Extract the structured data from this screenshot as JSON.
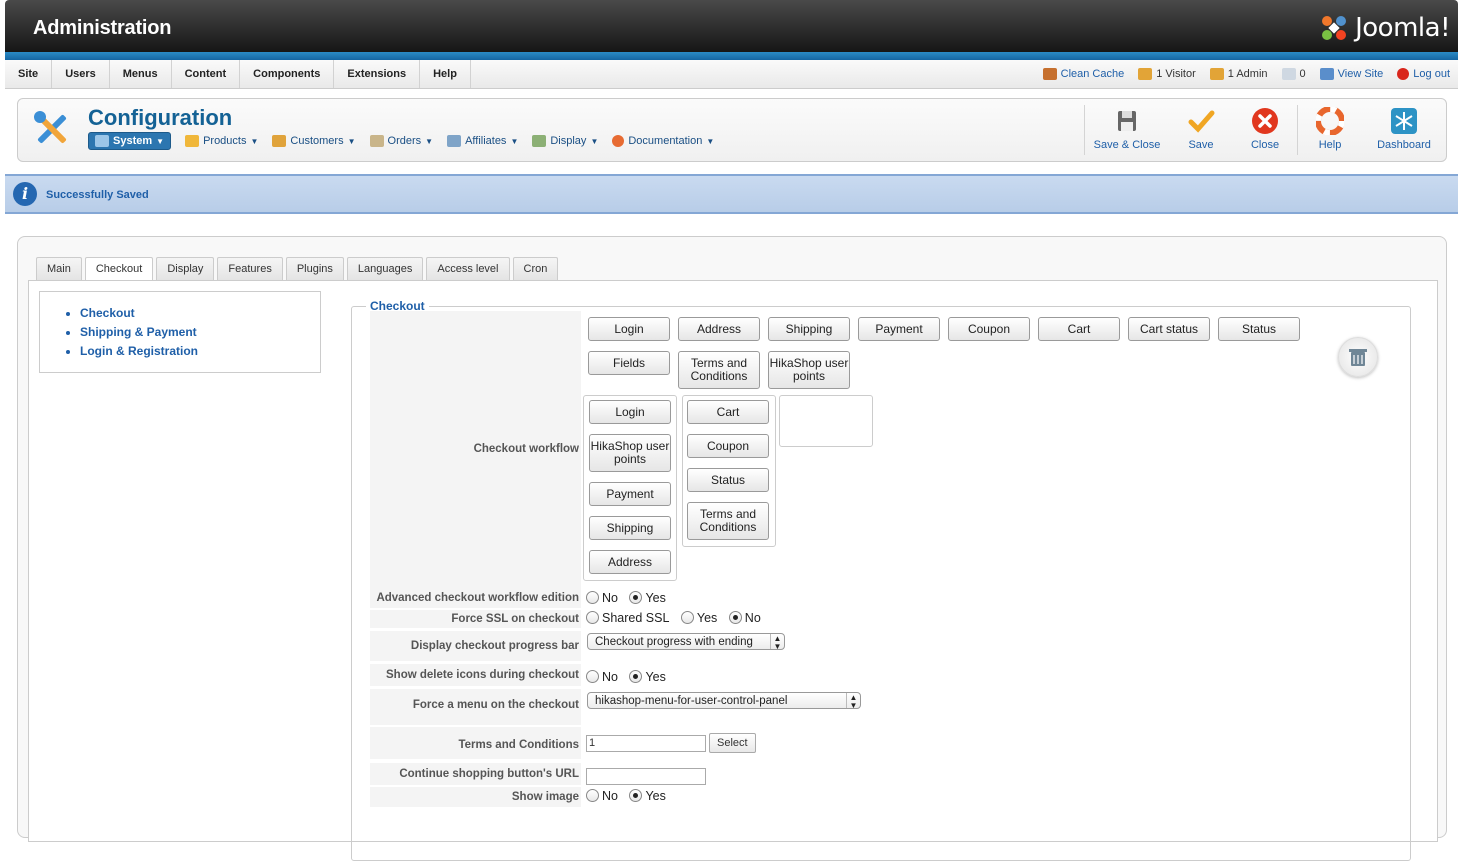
{
  "header": {
    "title": "Administration",
    "brand": "Joomla!"
  },
  "menu": [
    "Site",
    "Users",
    "Menus",
    "Content",
    "Components",
    "Extensions",
    "Help"
  ],
  "status": {
    "clean_cache": "Clean Cache",
    "visitors": "1 Visitor",
    "admins": "1 Admin",
    "messages": "0",
    "view_site": "View Site",
    "logout": "Log out"
  },
  "toolbar": {
    "title": "Configuration",
    "submenu": [
      {
        "label": "System",
        "icon": "tools-icon"
      },
      {
        "label": "Products",
        "icon": "box-icon"
      },
      {
        "label": "Customers",
        "icon": "users-icon"
      },
      {
        "label": "Orders",
        "icon": "orders-icon"
      },
      {
        "label": "Affiliates",
        "icon": "affiliates-icon"
      },
      {
        "label": "Display",
        "icon": "display-icon"
      },
      {
        "label": "Documentation",
        "icon": "lifebuoy-icon"
      }
    ],
    "buttons": [
      {
        "label": "Save & Close",
        "icon": "floppy-icon"
      },
      {
        "label": "Save",
        "icon": "checkmark-icon"
      },
      {
        "label": "Close",
        "icon": "close-icon"
      },
      {
        "label": "Help",
        "icon": "lifebuoy-icon"
      },
      {
        "label": "Dashboard",
        "icon": "dashboard-icon"
      }
    ]
  },
  "message": {
    "text": "Successfully Saved",
    "icon": "info-icon"
  },
  "tabs": [
    "Main",
    "Checkout",
    "Display",
    "Features",
    "Plugins",
    "Languages",
    "Access level",
    "Cron"
  ],
  "active_tab": "Checkout",
  "sidenav": [
    "Checkout",
    "Shipping & Payment",
    "Login & Registration"
  ],
  "checkout": {
    "legend": "Checkout",
    "workflow_label": "Checkout workflow",
    "palette": [
      "Login",
      "Address",
      "Shipping",
      "Payment",
      "Coupon",
      "Cart",
      "Cart status",
      "Status",
      "Fields",
      "Terms and Conditions",
      "HikaShop user points"
    ],
    "step1": [
      "Login",
      "HikaShop user points",
      "Payment",
      "Shipping",
      "Address"
    ],
    "step2": [
      "Cart",
      "Coupon",
      "Status",
      "Terms and Conditions"
    ],
    "advanced": {
      "label": "Advanced checkout workflow edition",
      "options": [
        "No",
        "Yes"
      ],
      "selected": "Yes"
    },
    "force_ssl": {
      "label": "Force SSL on checkout",
      "options": [
        "Shared SSL",
        "Yes",
        "No"
      ],
      "selected": "No"
    },
    "progress_bar": {
      "label": "Display checkout progress bar",
      "value": "Checkout progress with ending"
    },
    "delete_icons": {
      "label": "Show delete icons during checkout",
      "options": [
        "No",
        "Yes"
      ],
      "selected": "Yes"
    },
    "force_menu": {
      "label": "Force a menu on the checkout",
      "value": "hikashop-menu-for-user-control-panel"
    },
    "terms": {
      "label": "Terms and Conditions",
      "value": "1",
      "button": "Select"
    },
    "continue_url": {
      "label": "Continue shopping button's URL",
      "value": ""
    },
    "show_image": {
      "label": "Show image",
      "options": [
        "No",
        "Yes"
      ],
      "selected": "Yes"
    }
  }
}
